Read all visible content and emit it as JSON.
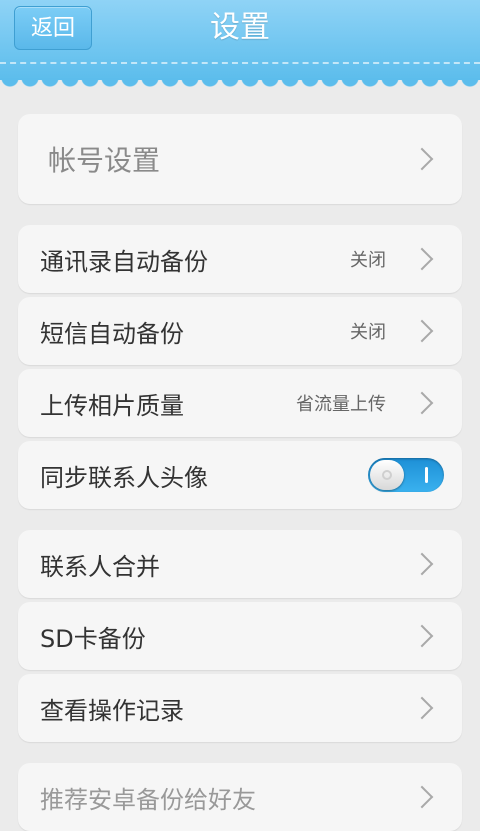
{
  "header": {
    "back_label": "返回",
    "title": "设置"
  },
  "items": {
    "account": {
      "label": "帐号设置"
    },
    "contacts_backup": {
      "label": "通讯录自动备份",
      "value": "关闭"
    },
    "sms_backup": {
      "label": "短信自动备份",
      "value": "关闭"
    },
    "photo_quality": {
      "label": "上传相片质量",
      "value": "省流量上传"
    },
    "sync_avatar": {
      "label": "同步联系人头像",
      "toggle_on": true
    },
    "merge_contacts": {
      "label": "联系人合并"
    },
    "sd_backup": {
      "label": "SD卡备份"
    },
    "operation_log": {
      "label": "查看操作记录"
    },
    "recommend": {
      "label": "推荐安卓备份给好友"
    }
  },
  "colors": {
    "header": "#5cbdec",
    "background": "#ebebeb",
    "card": "#f6f6f6",
    "toggle_on": "#2a9fe4"
  }
}
